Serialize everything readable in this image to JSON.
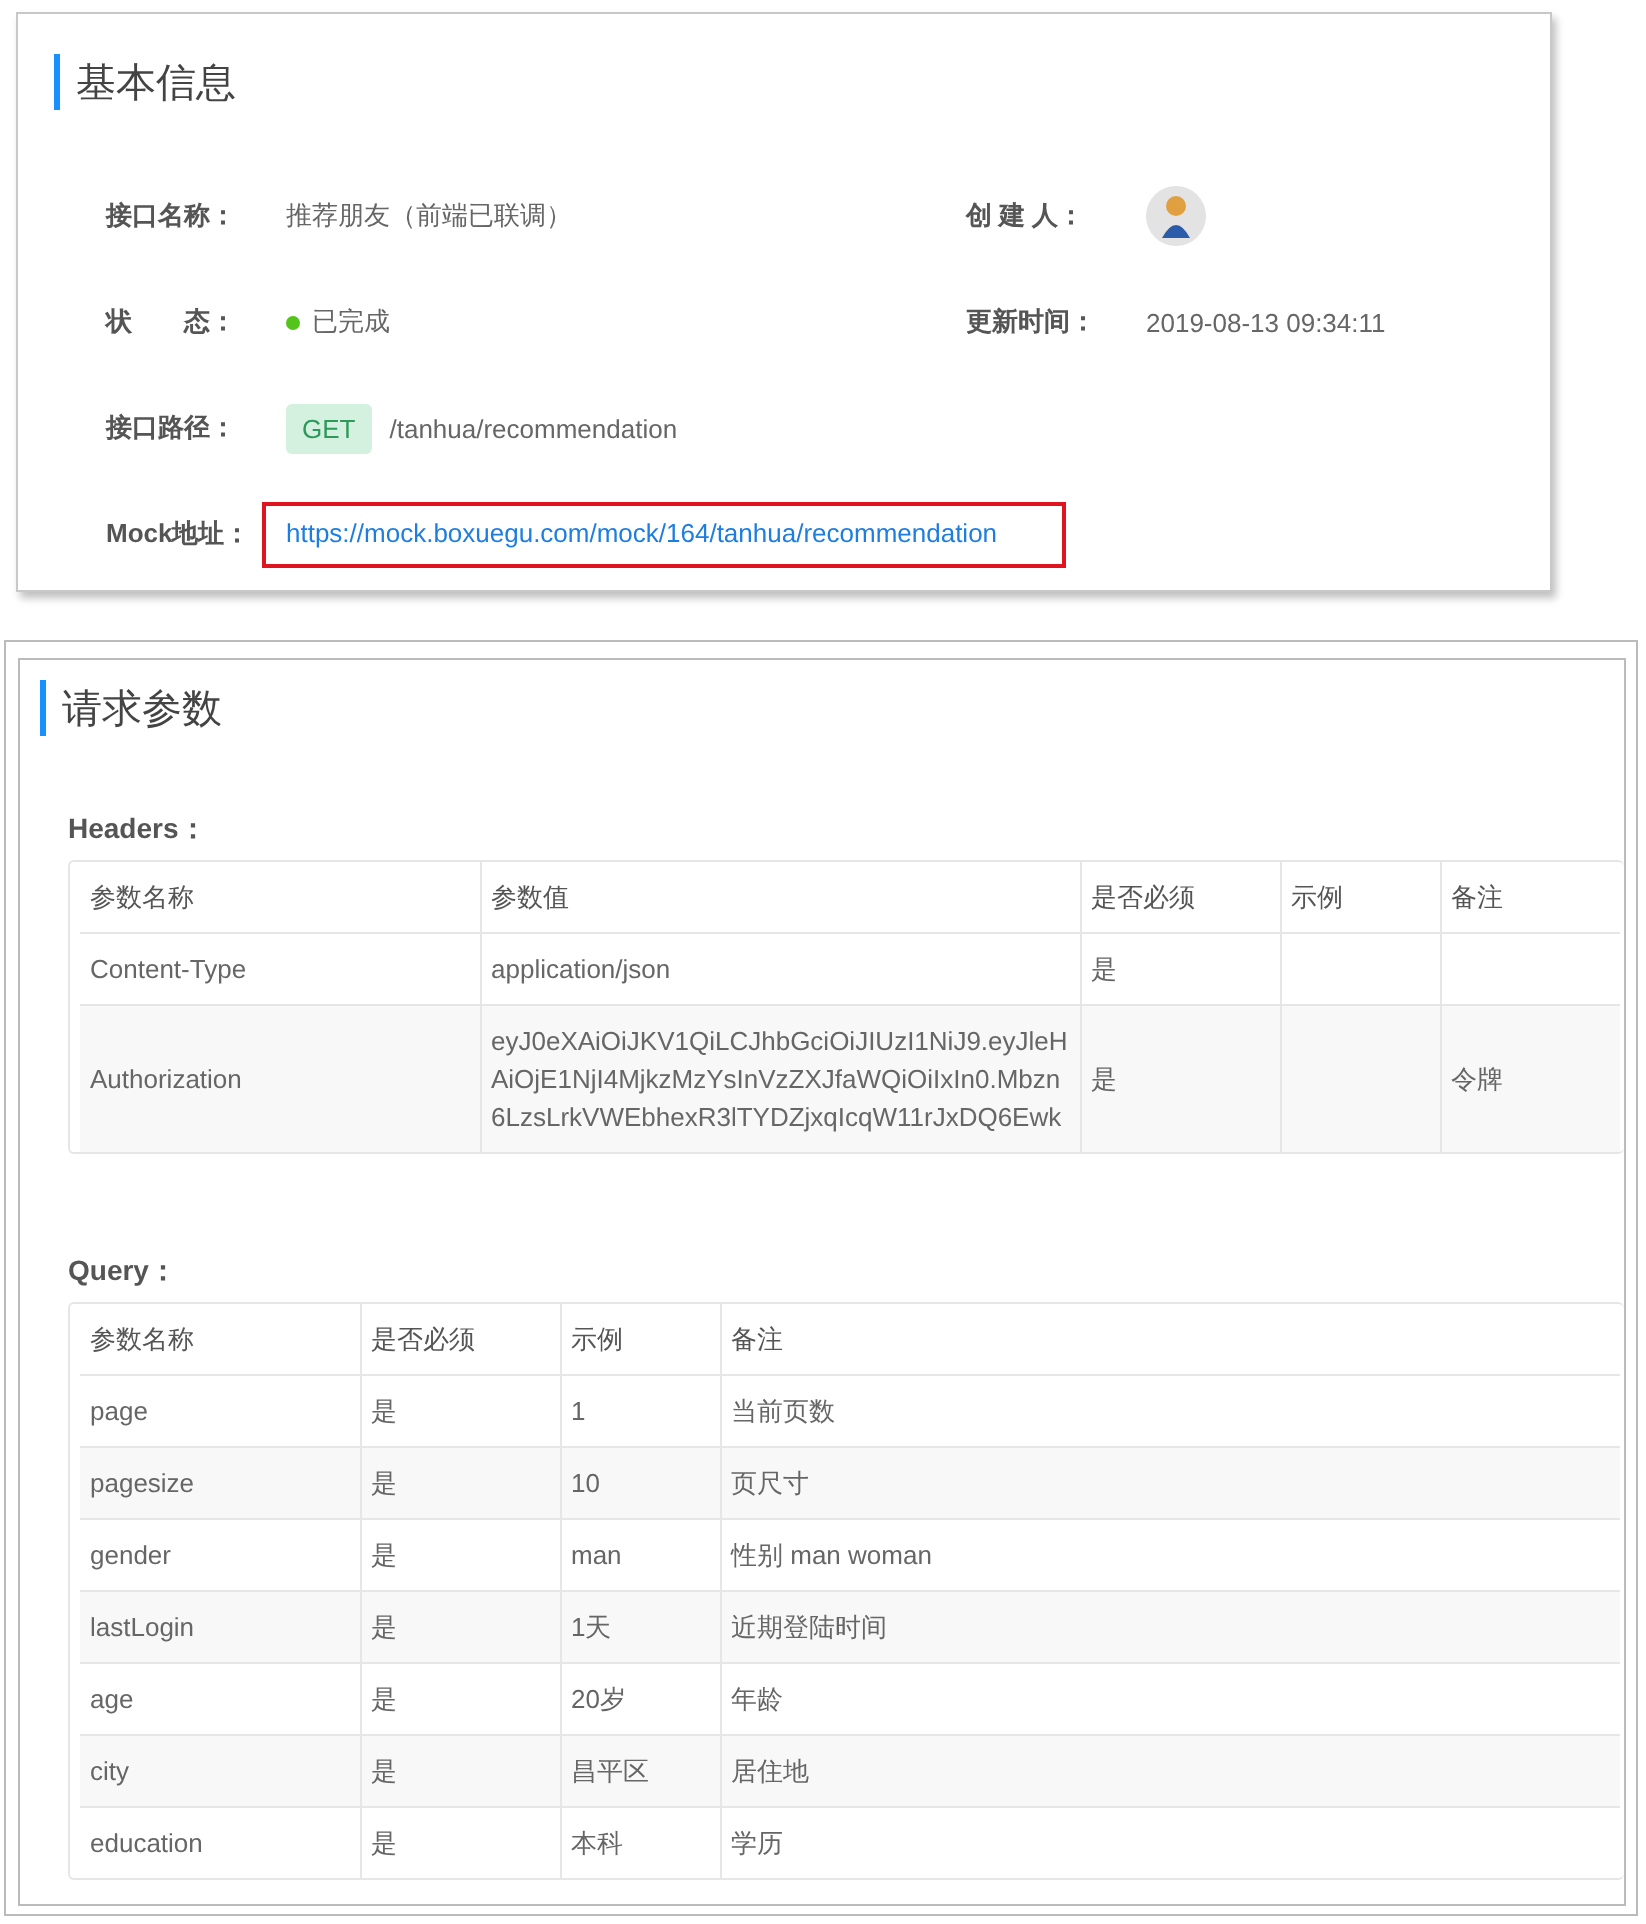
{
  "basic_info": {
    "title": "基本信息",
    "fields": [
      {
        "kind": "text",
        "label": "接口名称：",
        "value": "推荐朋友（前端已联调）"
      },
      {
        "kind": "avatar",
        "label": "创 建 人："
      },
      {
        "kind": "status",
        "label": "状　　态：",
        "value": "已完成",
        "color": "#52c41a"
      },
      {
        "kind": "text",
        "label": "更新时间：",
        "value": "2019-08-13 09:34:11"
      },
      {
        "kind": "path",
        "label": "接口路径：",
        "method": "GET",
        "value": "/tanhua/recommendation"
      },
      {
        "kind": "link",
        "label": "Mock地址：",
        "value": "https://mock.boxuegu.com/mock/164/tanhua/recommendation",
        "highlighted": true
      }
    ]
  },
  "request_params": {
    "title": "请求参数",
    "headers": {
      "title": "Headers：",
      "columns": [
        "参数名称",
        "参数值",
        "是否必须",
        "示例",
        "备注"
      ],
      "rows": [
        [
          "Content-Type",
          "application/json",
          "是",
          "",
          ""
        ],
        [
          "Authorization",
          "eyJ0eXAiOiJKV1QiLCJhbGciOiJIUzI1NiJ9.eyJleHAiOjE1NjI4MjkzMzYsInVzZXJfaWQiOiIxIn0.Mbzn6LzsLrkVWEbhexR3lTYDZjxqIcqW11rJxDQ6Ewk",
          "是",
          "",
          "令牌"
        ]
      ]
    },
    "query": {
      "title": "Query：",
      "columns": [
        "参数名称",
        "是否必须",
        "示例",
        "备注"
      ],
      "rows": [
        [
          "page",
          "是",
          "1",
          "当前页数"
        ],
        [
          "pagesize",
          "是",
          "10",
          "页尺寸"
        ],
        [
          "gender",
          "是",
          "man",
          "性别 man woman"
        ],
        [
          "lastLogin",
          "是",
          "1天",
          "近期登陆时间"
        ],
        [
          "age",
          "是",
          "20岁",
          "年龄"
        ],
        [
          "city",
          "是",
          "昌平区",
          "居住地"
        ],
        [
          "education",
          "是",
          "本科",
          "学历"
        ]
      ]
    }
  }
}
